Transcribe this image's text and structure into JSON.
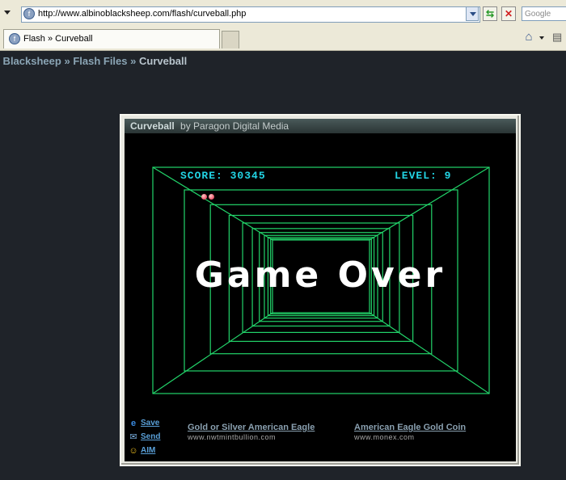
{
  "browser": {
    "url": "http://www.albinoblacksheep.com/flash/curveball.php",
    "search_placeholder": "Google",
    "tab_label": "Flash » Curveball"
  },
  "breadcrumb": {
    "site": "o Blacksheep",
    "section": "Flash Files",
    "current": "Curveball",
    "separator": "»"
  },
  "game": {
    "title": "Curveball",
    "author": "by Paragon Digital Media",
    "score_text": "SCORE: 30345",
    "level_text": "LEVEL: 9",
    "score": 30345,
    "level": 9,
    "lives_remaining": 2,
    "message": "Game Over"
  },
  "footer": {
    "save": "Save",
    "send": "Send",
    "aim": "AIM",
    "ads": [
      {
        "title": "Gold or Silver American Eagle",
        "url": "www.nwtmintbullion.com"
      },
      {
        "title": "American Eagle Gold Coin",
        "url": "www.monex.com"
      }
    ]
  },
  "colors": {
    "tunnel": "#22d46a",
    "hud": "#22d4e4",
    "page_bg": "#1f2329"
  },
  "icons": [
    "back-arrow-icon",
    "page-icon",
    "dropdown-icon",
    "go-icon",
    "stop-icon",
    "home-icon",
    "print-icon",
    "ie-icon",
    "send-icon",
    "aim-icon"
  ]
}
